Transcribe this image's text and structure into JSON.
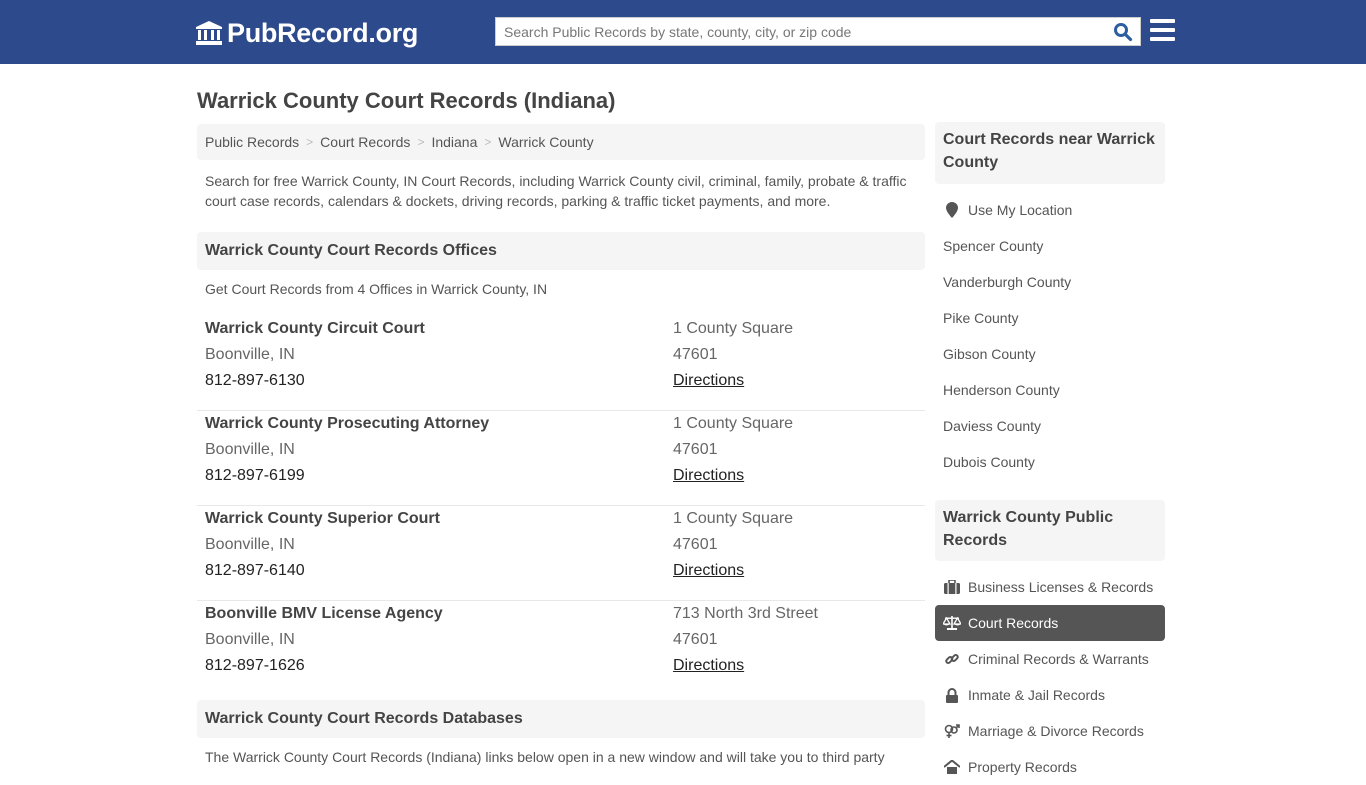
{
  "header": {
    "logo_text": "PubRecord.org",
    "search_placeholder": "Search Public Records by state, county, city, or zip code"
  },
  "page": {
    "title": "Warrick County Court Records (Indiana)",
    "breadcrumb": [
      "Public Records",
      "Court Records",
      "Indiana",
      "Warrick County"
    ],
    "intro": "Search for free Warrick County, IN Court Records, including Warrick County civil, criminal, family, probate & traffic court case records, calendars & dockets, driving records, parking & traffic ticket payments, and more."
  },
  "offices_section": {
    "heading": "Warrick County Court Records Offices",
    "subheading": "Get Court Records from 4 Offices in Warrick County, IN",
    "offices": [
      {
        "name": "Warrick County Circuit Court",
        "city": "Boonville, IN",
        "phone": "812-897-6130",
        "address": "1 County Square",
        "zip": "47601",
        "directions": "Directions"
      },
      {
        "name": "Warrick County Prosecuting Attorney",
        "city": "Boonville, IN",
        "phone": "812-897-6199",
        "address": "1 County Square",
        "zip": "47601",
        "directions": "Directions"
      },
      {
        "name": "Warrick County Superior Court",
        "city": "Boonville, IN",
        "phone": "812-897-6140",
        "address": "1 County Square",
        "zip": "47601",
        "directions": "Directions"
      },
      {
        "name": "Boonville BMV License Agency",
        "city": "Boonville, IN",
        "phone": "812-897-1626",
        "address": "713 North 3rd Street",
        "zip": "47601",
        "directions": "Directions"
      }
    ]
  },
  "databases_section": {
    "heading": "Warrick County Court Records Databases",
    "text": "The Warrick County Court Records (Indiana) links below open in a new window and will take you to third party"
  },
  "sidebar": {
    "nearby_heading": "Court Records near Warrick County",
    "use_location": "Use My Location",
    "nearby": [
      "Spencer County",
      "Vanderburgh County",
      "Pike County",
      "Gibson County",
      "Henderson County",
      "Daviess County",
      "Dubois County"
    ],
    "public_heading": "Warrick County Public Records",
    "public_records": [
      {
        "label": "Business Licenses & Records",
        "icon": "briefcase-icon",
        "active": false
      },
      {
        "label": "Court Records",
        "icon": "scale-icon",
        "active": true
      },
      {
        "label": "Criminal Records & Warrants",
        "icon": "link-icon",
        "active": false
      },
      {
        "label": "Inmate & Jail Records",
        "icon": "lock-icon",
        "active": false
      },
      {
        "label": "Marriage & Divorce Records",
        "icon": "gender-icon",
        "active": false
      },
      {
        "label": "Property Records",
        "icon": "home-icon",
        "active": false
      }
    ]
  },
  "colors": {
    "header_bg": "#2d4a8c",
    "active_item_bg": "#555555",
    "panel_bg": "#f5f5f5",
    "search_icon": "#2d5fa0"
  }
}
